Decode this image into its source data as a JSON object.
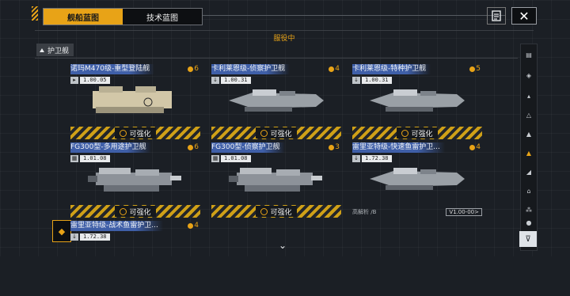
{
  "tabs": [
    {
      "label": "舰船蓝图",
      "active": true
    },
    {
      "label": "技术蓝图",
      "active": false
    }
  ],
  "section_title": "服役中",
  "category": "护卫舰",
  "cards": [
    {
      "name": "诺玛M470级-重型登陆舰",
      "tier": "6",
      "version": "1.00.05",
      "action": "可强化"
    },
    {
      "name": "卡利莱恩级-侦察护卫舰",
      "tier": "4",
      "version": "1.00.31",
      "action": "可强化"
    },
    {
      "name": "卡利莱恩级-特种护卫舰",
      "tier": "5",
      "version": "1.00.31",
      "action": "可强化"
    },
    {
      "name": "FG300型-多用途护卫舰",
      "tier": "6",
      "version": "1.01.08",
      "action": "可强化"
    },
    {
      "name": "FG300型-侦察护卫舰",
      "tier": "3",
      "version": "1.01.08",
      "action": "可强化"
    },
    {
      "name": "雷里亚特级-快速鱼雷护卫...",
      "tier": "4",
      "version": "1.72.38",
      "stamp": "高解析 /B",
      "version_tag": "V1.00-00>"
    },
    {
      "name": "雷里亚特级-战术鱼雷护卫...",
      "tier": "4",
      "version": "1.72.38"
    }
  ],
  "colors": {
    "accent": "#e8a317",
    "title_bg": "#3f5fa8",
    "background": "#1b1f25"
  },
  "icons": {
    "close": "close-icon",
    "notes": "notes-icon",
    "filter": "filter-icon",
    "scroll": "chevron-down-icon"
  }
}
